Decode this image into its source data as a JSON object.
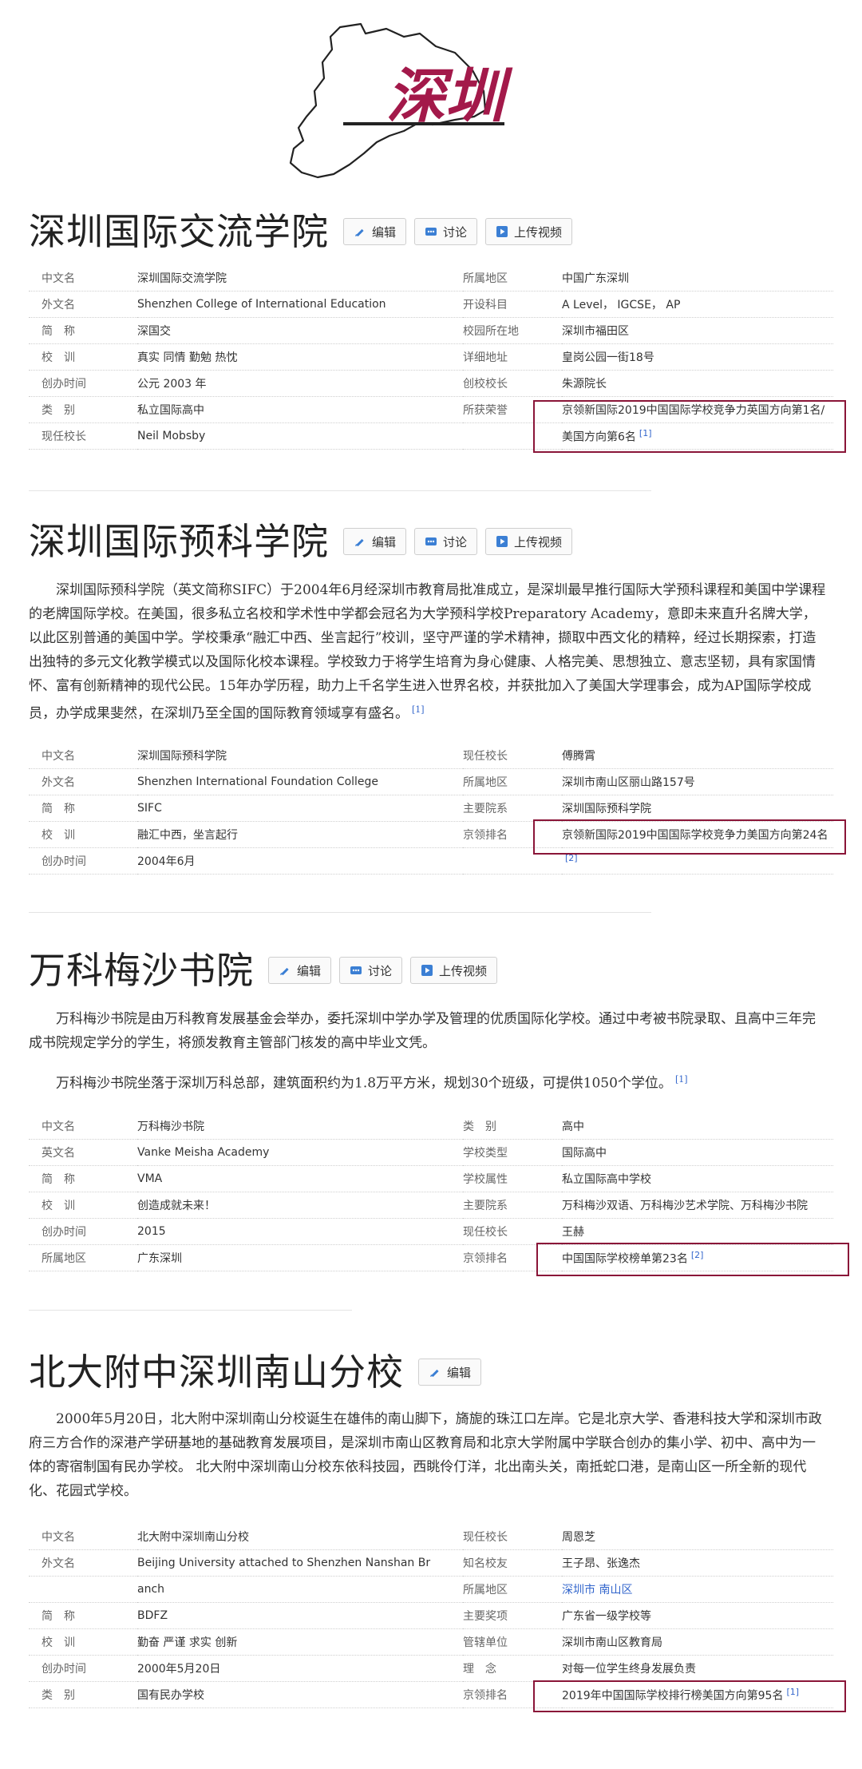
{
  "logo": {
    "text": "深圳",
    "color": "#a3194a"
  },
  "buttons": {
    "edit": "编辑",
    "discuss": "讨论",
    "upload": "上传视频"
  },
  "colors": {
    "highlight": "#8a1538",
    "link": "#3366cc"
  },
  "s1": {
    "title": "深圳国际交流学院",
    "rows": [
      [
        "中文名",
        "深圳国际交流学院",
        "所属地区",
        "中国广东深圳"
      ],
      [
        "外文名",
        "Shenzhen College of International Education",
        "开设科目",
        "A Level， IGCSE， AP"
      ],
      [
        "简　称",
        "深国交",
        "校园所在地",
        "深圳市福田区"
      ],
      [
        "校　训",
        "真实 同情 勤勉 热忱",
        "详细地址",
        "皇岗公园一街18号"
      ],
      [
        "创办时间",
        "公元 2003 年",
        "创校校长",
        "朱源院长"
      ],
      [
        "类　别",
        "私立国际高中",
        "所获荣誉",
        "京领新国际2019中国国际学校竞争力英国方向第1名/"
      ],
      [
        "现任校长",
        "Neil Mobsby",
        "",
        "美国方向第6名"
      ]
    ],
    "ref": "[1]"
  },
  "s2": {
    "title": "深圳国际预科学院",
    "para": "深圳国际预科学院（英文简称SIFC）于2004年6月经深圳市教育局批准成立，是深圳最早推行国际大学预科课程和美国中学课程的老牌国际学校。在美国，很多私立名校和学术性中学都会冠名为大学预科学校Preparatory Academy，意即未来直升名牌大学，以此区别普通的美国中学。学校秉承“融汇中西、坐言起行”校训，坚守严谨的学术精神，撷取中西文化的精粹，经过长期探索，打造出独特的多元文化教学模式以及国际化校本课程。学校致力于将学生培育为身心健康、人格完美、思想独立、意志坚韧，具有家国情怀、富有创新精神的现代公民。15年办学历程，助力上千名学生进入世界名校，并获批加入了美国大学理事会，成为AP国际学校成员，办学成果斐然，在深圳乃至全国的国际教育领域享有盛名。",
    "para_ref": "[1]",
    "rows": [
      [
        "中文名",
        "深圳国际预科学院",
        "现任校长",
        "傅腾霄"
      ],
      [
        "外文名",
        "Shenzhen International Foundation College",
        "所属地区",
        "深圳市南山区丽山路157号"
      ],
      [
        "简　称",
        "SIFC",
        "主要院系",
        "深圳国际预科学院"
      ],
      [
        "校　训",
        "融汇中西，坐言起行",
        "京领排名",
        "京领新国际2019中国国际学校竞争力美国方向第24名"
      ],
      [
        "创办时间",
        "2004年6月",
        "",
        ""
      ]
    ],
    "ref": "[2]"
  },
  "s3": {
    "title": "万科梅沙书院",
    "para1": "万科梅沙书院是由万科教育发展基金会举办，委托深圳中学办学及管理的优质国际化学校。通过中考被书院录取、且高中三年完成书院规定学分的学生，将颁发教育主管部门核发的高中毕业文凭。",
    "para2": "万科梅沙书院坐落于深圳万科总部，建筑面积约为1.8万平方米，规划30个班级，可提供1050个学位。",
    "para_ref": "[1]",
    "rows": [
      [
        "中文名",
        "万科梅沙书院",
        "类　别",
        "高中"
      ],
      [
        "英文名",
        "Vanke Meisha Academy",
        "学校类型",
        "国际高中"
      ],
      [
        "简　称",
        "VMA",
        "学校属性",
        "私立国际高中学校"
      ],
      [
        "校　训",
        "创造成就未来！",
        "主要院系",
        "万科梅沙双语、万科梅沙艺术学院、万科梅沙书院"
      ],
      [
        "创办时间",
        "2015",
        "现任校长",
        "王赫"
      ],
      [
        "所属地区",
        "广东深圳",
        "京领排名",
        "中国国际学校榜单第23名"
      ]
    ],
    "ref": "[2]"
  },
  "s4": {
    "title": "北大附中深圳南山分校",
    "para": "2000年5月20日，北大附中深圳南山分校诞生在雄伟的南山脚下，旖旎的珠江口左岸。它是北京大学、香港科技大学和深圳市政府三方合作的深港产学研基地的基础教育发展项目，是深圳市南山区教育局和北京大学附属中学联合创办的集小学、初中、高中为一体的寄宿制国有民办学校。 北大附中深圳南山分校东依科技园，西眺伶仃洋，北出南头关，南抵蛇口港，是南山区一所全新的现代化、花园式学校。",
    "rows": [
      [
        "中文名",
        "北大附中深圳南山分校",
        "现任校长",
        "周恩芝"
      ],
      [
        "外文名",
        "Beijing University attached to Shenzhen Nanshan Br",
        "知名校友",
        "王子昂、张逸杰"
      ],
      [
        "",
        "anch",
        "所属地区",
        "深圳市 南山区"
      ],
      [
        "简　称",
        "BDFZ",
        "主要奖项",
        "广东省一级学校等"
      ],
      [
        "校　训",
        "勤奋 严谨 求实 创新",
        "管辖单位",
        "深圳市南山区教育局"
      ],
      [
        "创办时间",
        "2000年5月20日",
        "理　念",
        "对每一位学生终身发展负责"
      ],
      [
        "类　别",
        "国有民办学校",
        "京领排名",
        "2019年中国国际学校排行榜美国方向第95名"
      ]
    ],
    "ref": "[1]"
  }
}
